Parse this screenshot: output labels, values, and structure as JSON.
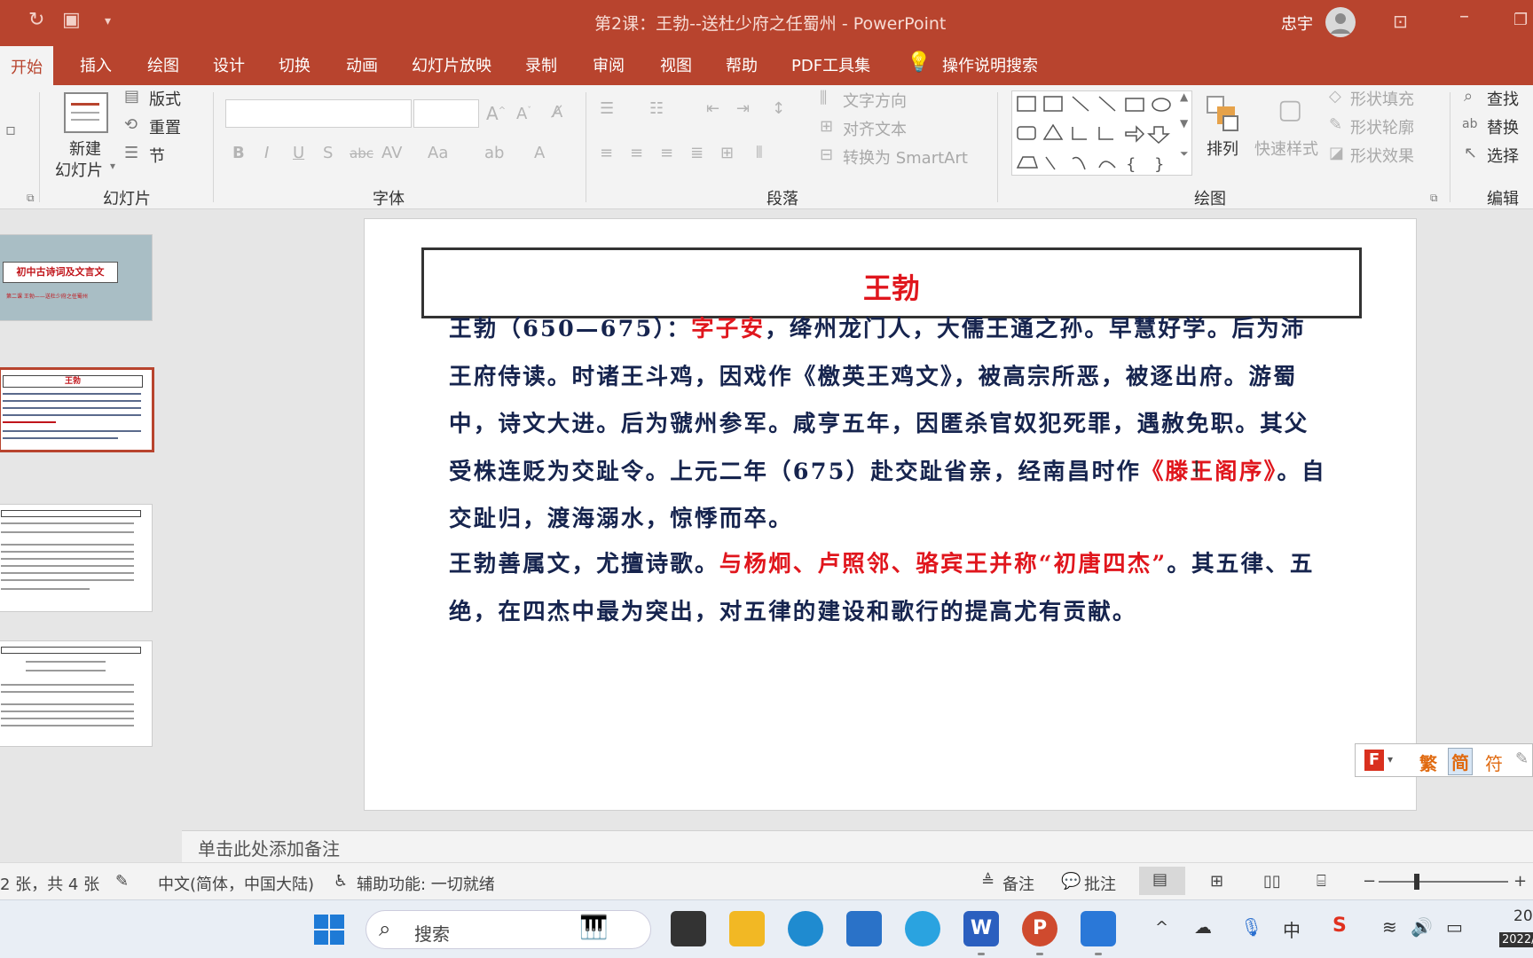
{
  "app": {
    "window_title": "第2课：王勃--送杜少府之任蜀州  -  PowerPoint",
    "user": "忠宇"
  },
  "tabs": [
    "开始",
    "插入",
    "绘图",
    "设计",
    "切换",
    "动画",
    "幻灯片放映",
    "录制",
    "审阅",
    "视图",
    "帮助",
    "PDF工具集"
  ],
  "search_label": "操作说明搜索",
  "ribbon": {
    "slides_group": {
      "new_slide": "新建",
      "new_slide_2": "幻灯片",
      "layout": "版式",
      "reset": "重置",
      "section": "节",
      "label": "幻灯片"
    },
    "font_group": {
      "label": "字体"
    },
    "paragraph_group": {
      "text_direction": "文字方向",
      "align_text": "对齐文本",
      "smartart": "转换为 SmartArt",
      "label": "段落"
    },
    "drawing_group": {
      "arrange": "排列",
      "quick_styles": "快速样式",
      "shape_fill": "形状填充",
      "shape_outline": "形状轮廓",
      "shape_effects": "形状效果",
      "label": "绘图"
    },
    "editing_group": {
      "find": "查找",
      "replace": "替换",
      "select": "选择",
      "label": "编辑"
    }
  },
  "thumbnails": {
    "slide1_title": "初中古诗词及文言文",
    "slide1_sub": "第二课 王勃——送杜少府之任蜀州",
    "slide2_title": "王勃"
  },
  "slide": {
    "title": "王勃",
    "p1_a": "王勃（650—675）：",
    "p1_red": "字子安",
    "p1_b": "，绛州龙门人，大儒王通之孙。早慧好学。后为沛王府侍读。时诸王斗鸡，因戏作《檄英王鸡文》，被高宗所恶，被逐出府。游蜀中，诗文大进。后为虢州参军。咸亨五年，因匿杀官奴犯死罪，遇赦免职。其父受株连贬为交趾令。上元二年（675）赴交趾省亲，经南昌时作",
    "p1_red2": "《滕王阁序》",
    "p1_c": "。自交趾归，渡海溺水，惊悸而卒。",
    "p2_a": "王勃善属文，尤擅诗歌。",
    "p2_red": "与杨炯、卢照邻、骆宾王并称“初唐四杰”",
    "p2_b": "。其五律、五绝，在四杰中最为突出，对五律的建设和歌行的提高尤有贡献。"
  },
  "notes_placeholder": "单击此处添加备注",
  "status": {
    "slide_count": "2 张，共 4 张",
    "language": "中文(简体，中国大陆)",
    "accessibility": "辅助功能: 一切就绪",
    "notes": "备注",
    "comments": "批注"
  },
  "ime": {
    "trad": "繁",
    "simp": "简"
  },
  "taskbar": {
    "search": "搜索",
    "ime_lang": "中",
    "clock_line1": "20",
    "clock_line2": "2022/"
  },
  "colors": {
    "accent": "#b8442e",
    "slide_red": "#e0161d",
    "slide_text": "#16244e"
  }
}
